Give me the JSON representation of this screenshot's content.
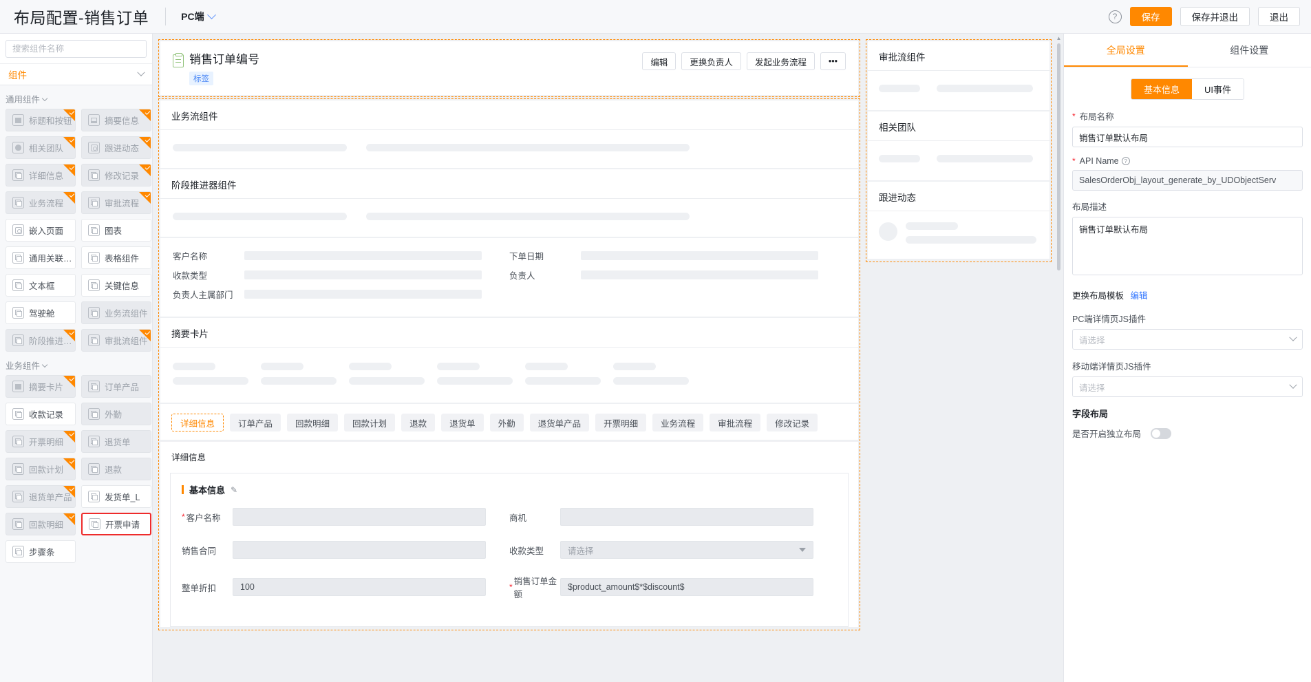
{
  "topbar": {
    "title": "布局配置-销售订单",
    "device": "PC端",
    "help_icon": "?",
    "save": "保存",
    "save_exit": "保存并退出",
    "exit": "退出"
  },
  "sidebar": {
    "search_placeholder": "搜索组件名称",
    "section": "组件",
    "groups": [
      {
        "label": "通用组件",
        "items": [
          {
            "label": "标题和按钮",
            "icon": "sq",
            "used": true
          },
          {
            "label": "摘要信息",
            "icon": "win",
            "used": true
          },
          {
            "label": "相关团队",
            "icon": "per",
            "used": true
          },
          {
            "label": "跟进动态",
            "icon": "at",
            "used": true
          },
          {
            "label": "详细信息",
            "icon": "ov",
            "used": true
          },
          {
            "label": "修改记录",
            "icon": "ov",
            "used": true
          },
          {
            "label": "业务流程",
            "icon": "ov",
            "used": true
          },
          {
            "label": "审批流程",
            "icon": "ov",
            "used": true
          },
          {
            "label": "嵌入页面",
            "icon": "at",
            "used": false
          },
          {
            "label": "图表",
            "icon": "ov",
            "used": false
          },
          {
            "label": "通用关联组...",
            "icon": "ov",
            "used": false
          },
          {
            "label": "表格组件",
            "icon": "ov",
            "used": false
          },
          {
            "label": "文本框",
            "icon": "ov",
            "used": false
          },
          {
            "label": "关键信息",
            "icon": "ov",
            "used": false
          },
          {
            "label": "驾驶舱",
            "icon": "ov",
            "used": false
          },
          {
            "label": "业务流组件",
            "icon": "ov",
            "used": true,
            "nobadge": true
          },
          {
            "label": "阶段推进器...",
            "icon": "ov",
            "used": true
          },
          {
            "label": "审批流组件",
            "icon": "ov",
            "used": true
          }
        ]
      },
      {
        "label": "业务组件",
        "items": [
          {
            "label": "摘要卡片",
            "icon": "sq",
            "used": true
          },
          {
            "label": "订单产品",
            "icon": "ov",
            "used": true,
            "nobadge": true
          },
          {
            "label": "收款记录",
            "icon": "ov",
            "used": false
          },
          {
            "label": "外勤",
            "icon": "ov",
            "used": true,
            "nobadge": true
          },
          {
            "label": "开票明细",
            "icon": "ov",
            "used": true
          },
          {
            "label": "退货单",
            "icon": "ov",
            "used": true,
            "nobadge": true
          },
          {
            "label": "回款计划",
            "icon": "ov",
            "used": true
          },
          {
            "label": "退款",
            "icon": "ov",
            "used": true,
            "nobadge": true
          },
          {
            "label": "退货单产品",
            "icon": "ov",
            "used": true
          },
          {
            "label": "发货单_L",
            "icon": "ov",
            "used": false
          },
          {
            "label": "回款明细",
            "icon": "ov",
            "used": true
          },
          {
            "label": "开票申请",
            "icon": "ov",
            "used": false,
            "selected": true
          },
          {
            "label": "步骤条",
            "icon": "ov",
            "used": false
          }
        ]
      }
    ]
  },
  "canvas": {
    "record": {
      "title": "销售订单编号",
      "tag": "标签",
      "actions": [
        "编辑",
        "更换负责人",
        "发起业务流程",
        "•••"
      ]
    },
    "main_blocks": [
      {
        "title": "业务流组件"
      },
      {
        "title": "阶段推进器组件"
      }
    ],
    "summary_fields": {
      "rows": [
        [
          "客户名称",
          "下单日期"
        ],
        [
          "收款类型",
          "负责人"
        ],
        [
          "负责人主属部门",
          ""
        ]
      ]
    },
    "summary_card_title": "摘要卡片",
    "tabs": [
      "详细信息",
      "订单产品",
      "回款明细",
      "回款计划",
      "退款",
      "退货单",
      "外勤",
      "退货单产品",
      "开票明细",
      "业务流程",
      "审批流程",
      "修改记录"
    ],
    "active_tab": "详细信息",
    "detail_heading": "详细信息",
    "detail_section": {
      "title": "基本信息",
      "edit_icon": "pencil-icon",
      "rows": [
        [
          {
            "label": "客户名称",
            "required": true,
            "value": "",
            "type": "text"
          },
          {
            "label": "商机",
            "required": false,
            "value": "",
            "type": "text"
          }
        ],
        [
          {
            "label": "销售合同",
            "required": false,
            "value": "",
            "type": "text"
          },
          {
            "label": "收款类型",
            "required": false,
            "value": "请选择",
            "type": "select"
          }
        ],
        [
          {
            "label": "整单折扣",
            "required": false,
            "value": "100",
            "type": "text"
          },
          {
            "label": "销售订单金额",
            "required": true,
            "value": "$product_amount$*$discount$",
            "type": "text"
          }
        ]
      ]
    },
    "side_blocks": [
      {
        "title": "审批流组件",
        "kind": "bars"
      },
      {
        "title": "相关团队",
        "kind": "bars"
      },
      {
        "title": "跟进动态",
        "kind": "avatar"
      }
    ]
  },
  "right_panel": {
    "tabs": [
      {
        "label": "全局设置",
        "active": true
      },
      {
        "label": "组件设置",
        "active": false
      }
    ],
    "segments": [
      {
        "label": "基本信息",
        "on": true
      },
      {
        "label": "UI事件",
        "on": false
      }
    ],
    "layout_name_label": "布局名称",
    "layout_name_value": "销售订单默认布局",
    "api_name_label": "API Name",
    "api_name_value": "SalesOrderObj_layout_generate_by_UDObjectServ",
    "desc_label": "布局描述",
    "desc_value": "销售订单默认布局",
    "template_label": "更换布局模板",
    "template_edit": "编辑",
    "pc_plugin_label": "PC端详情页JS插件",
    "pc_plugin_placeholder": "请选择",
    "mobile_plugin_label": "移动端详情页JS插件",
    "mobile_plugin_placeholder": "请选择",
    "field_layout_title": "字段布局",
    "independent_label": "是否开启独立布局",
    "independent_on": false
  },
  "colors": {
    "accent": "#ff8800",
    "link": "#3377ff",
    "selected_border": "#ee2b2b",
    "tag_bg": "#e8f2ff",
    "tag_text": "#4a87f5"
  }
}
